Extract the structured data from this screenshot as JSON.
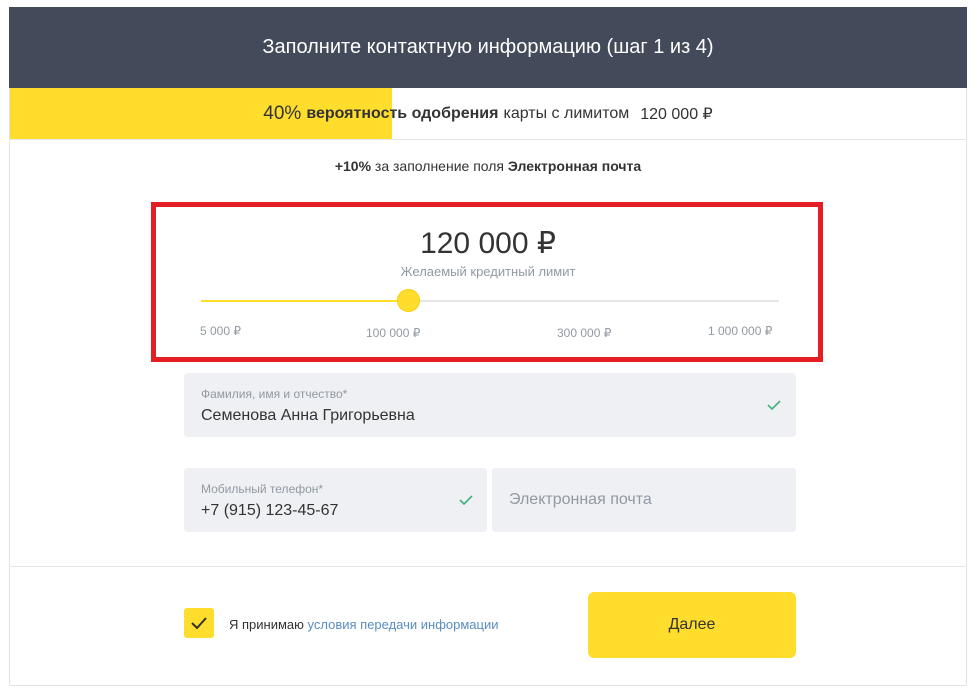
{
  "header": {
    "title": "Заполните контактную информацию (шаг 1 из 4)"
  },
  "approval": {
    "percent_label": "40%",
    "percent_value": 0.4,
    "bold_text": "вероятность одобрения",
    "text": "карты с лимитом",
    "amount": "120 000 ₽"
  },
  "bonus": {
    "plus": "+10%",
    "text": "за заполнение поля",
    "field": "Электронная почта"
  },
  "limit": {
    "amount": "120 000 ₽",
    "caption": "Желаемый кредитный лимит",
    "slider_value": "120 000 ₽",
    "ticks": [
      "5 000 ₽",
      "100 000 ₽",
      "300 000 ₽",
      "1 000 000 ₽"
    ]
  },
  "fields": {
    "full_name": {
      "label": "Фамилия, имя и отчество*",
      "value": "Семенова Анна Григорьевна",
      "valid": true
    },
    "phone": {
      "label": "Мобильный телефон*",
      "value": "+7 (915) 123-45-67",
      "valid": true
    },
    "email": {
      "placeholder": "Электронная почта",
      "value": ""
    }
  },
  "consent": {
    "checked": true,
    "text": "Я принимаю",
    "link": "условия передачи информации"
  },
  "next_button": {
    "label": "Далее"
  },
  "colors": {
    "header_bg": "#434a59",
    "accent_yellow": "#ffdd2d",
    "highlight_red": "#e31e24",
    "check_green": "#40b27d",
    "link_blue": "#5a8dbf"
  },
  "icons": {
    "valid": "check-icon",
    "checkbox": "checkmark-icon"
  }
}
